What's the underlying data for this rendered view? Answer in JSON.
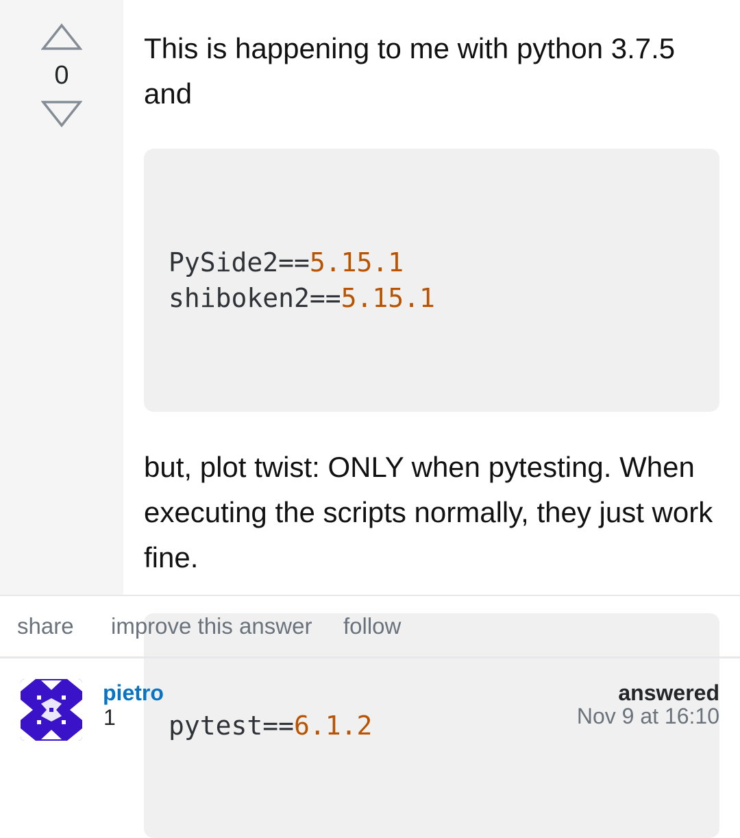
{
  "vote": {
    "count": "0"
  },
  "post": {
    "paragraph1": "This is happening to me with python 3.7.5 and",
    "code1": [
      {
        "name": "PySide2==",
        "version": "5.15.1"
      },
      {
        "name": "shiboken2==",
        "version": "5.15.1"
      }
    ],
    "paragraph2": "but, plot twist: ONLY when pytesting. When executing the scripts normally, they just work fine.",
    "code2": [
      {
        "name": "pytest==",
        "version": "6.1.2"
      }
    ]
  },
  "menu": {
    "share": "share",
    "improve": "improve this answer",
    "follow": "follow"
  },
  "user": {
    "name": "pietro",
    "reputation": "1",
    "avatar_icon": "identicon-avatar-icon",
    "avatar_color": "#3a12c8"
  },
  "meta": {
    "action": "answered",
    "date": "Nov 9 at 16:10"
  },
  "colors": {
    "link": "#0a74c4",
    "code_number": "#b75301",
    "vote_arrow": "#848d95"
  }
}
